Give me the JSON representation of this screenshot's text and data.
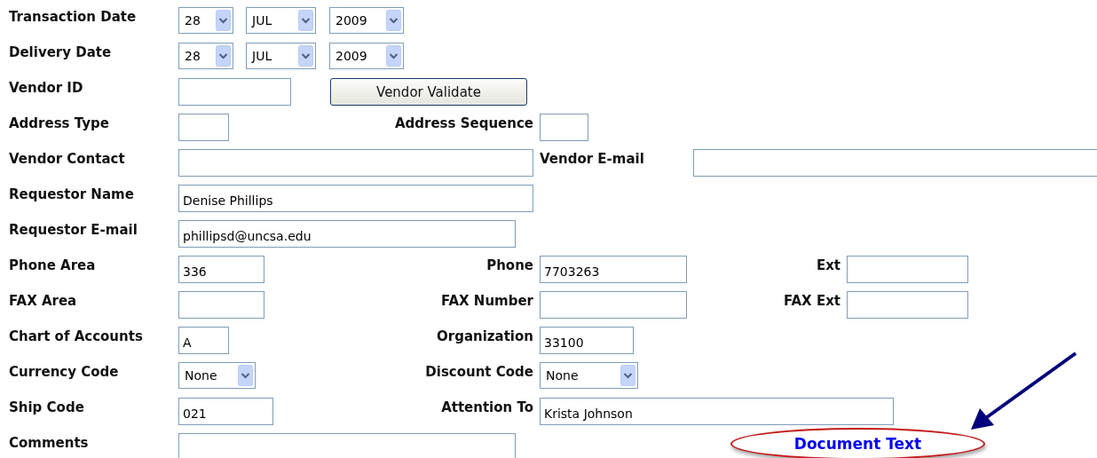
{
  "form": {
    "rows": [
      {
        "items": [
          {
            "kind": "label",
            "text": "Transaction Date"
          },
          {
            "kind": "select",
            "value": "28"
          },
          {
            "kind": "select",
            "value": "JUL"
          },
          {
            "kind": "select",
            "value": "2009"
          }
        ]
      },
      {
        "items": [
          {
            "kind": "label",
            "text": "Delivery Date"
          },
          {
            "kind": "select",
            "value": "28"
          },
          {
            "kind": "select",
            "value": "JUL"
          },
          {
            "kind": "select",
            "value": "2009"
          }
        ]
      },
      {
        "items": [
          {
            "kind": "label",
            "text": "Vendor ID"
          },
          {
            "kind": "input"
          },
          {
            "kind": "button",
            "text": "Vendor Validate"
          }
        ]
      },
      {
        "items": [
          {
            "kind": "label",
            "text": "Address Type"
          },
          {
            "kind": "input"
          },
          {
            "kind": "label",
            "text": "Address Sequence"
          },
          {
            "kind": "input"
          }
        ]
      },
      {
        "items": [
          {
            "kind": "label",
            "text": "Vendor Contact"
          },
          {
            "kind": "input"
          },
          {
            "kind": "label",
            "text": "Vendor E-mail"
          },
          {
            "kind": "input"
          }
        ]
      },
      {
        "items": [
          {
            "kind": "label",
            "text": "Requestor Name"
          },
          {
            "kind": "input",
            "value": "Denise Phillips"
          }
        ]
      },
      {
        "items": [
          {
            "kind": "label",
            "text": "Requestor E-mail"
          },
          {
            "kind": "input",
            "value": "phillipsd@uncsa.edu"
          }
        ]
      },
      {
        "items": [
          {
            "kind": "label",
            "text": "Phone Area"
          },
          {
            "kind": "input",
            "value": "336"
          },
          {
            "kind": "label",
            "text": "Phone"
          },
          {
            "kind": "input",
            "value": "7703263"
          },
          {
            "kind": "label",
            "text": "Ext"
          },
          {
            "kind": "input"
          }
        ]
      },
      {
        "items": [
          {
            "kind": "label",
            "text": "FAX Area"
          },
          {
            "kind": "input"
          },
          {
            "kind": "label",
            "text": "FAX Number"
          },
          {
            "kind": "input"
          },
          {
            "kind": "label",
            "text": "FAX Ext"
          },
          {
            "kind": "input"
          }
        ]
      },
      {
        "items": [
          {
            "kind": "label",
            "text": "Chart of Accounts"
          },
          {
            "kind": "input",
            "value": "A"
          },
          {
            "kind": "label",
            "text": "Organization"
          },
          {
            "kind": "input",
            "value": "33100"
          }
        ]
      },
      {
        "items": [
          {
            "kind": "label",
            "text": "Currency Code"
          },
          {
            "kind": "select",
            "value": "None"
          },
          {
            "kind": "label",
            "text": "Discount Code"
          },
          {
            "kind": "select",
            "value": "None"
          }
        ]
      },
      {
        "items": [
          {
            "kind": "label",
            "text": "Ship Code"
          },
          {
            "kind": "input",
            "value": "021"
          },
          {
            "kind": "label",
            "text": "Attention To"
          },
          {
            "kind": "input",
            "value": "Krista Johnson"
          }
        ]
      },
      {
        "items": [
          {
            "kind": "label",
            "text": "Comments"
          },
          {
            "kind": "input"
          },
          {
            "kind": "link",
            "text": "Document Text"
          }
        ]
      }
    ]
  }
}
